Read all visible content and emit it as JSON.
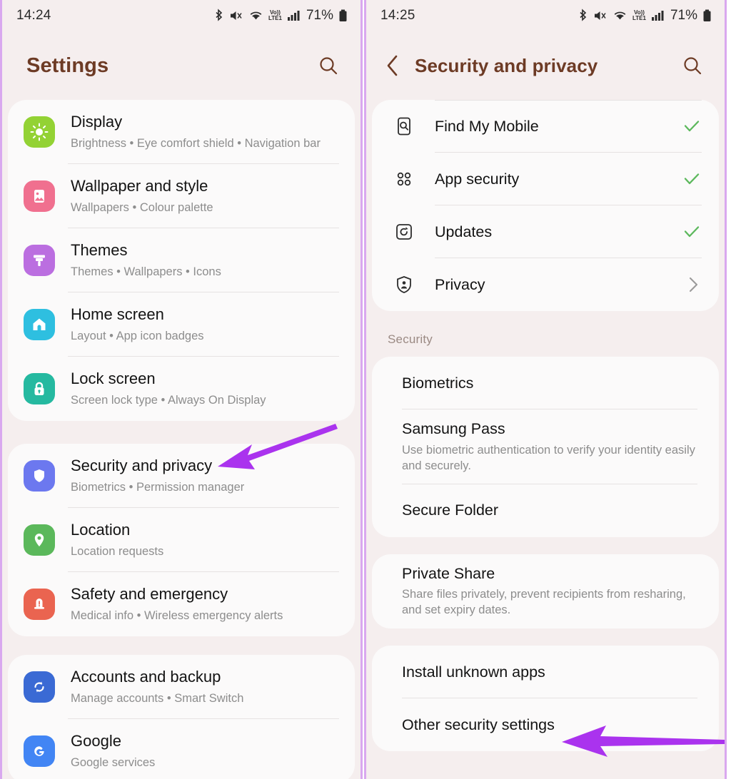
{
  "accent": {
    "arrow": "#aa33ee",
    "panel_border": "#d9a8ef",
    "title_brown": "#6d3b25",
    "check_green": "#5cb85c"
  },
  "left_phone": {
    "statusbar": {
      "clock": "14:24",
      "battery_percent": "71%",
      "icons": [
        "bluetooth-icon",
        "mute-icon",
        "wifi-icon",
        "volte-icon",
        "signal-bars-icon",
        "battery-icon"
      ],
      "volte_label": "Vo)) LTE1"
    },
    "header": {
      "title": "Settings",
      "search_icon": "search-icon"
    },
    "groups": [
      {
        "items": [
          {
            "icon": "display-brightness-icon",
            "color": "#93d234",
            "title": "Display",
            "subtitle": "Brightness  •  Eye comfort shield  •  Navigation bar"
          },
          {
            "icon": "wallpaper-image-icon",
            "color": "#f0708f",
            "title": "Wallpaper and style",
            "subtitle": "Wallpapers  •  Colour palette"
          },
          {
            "icon": "themes-brush-icon",
            "color": "#bb6ee0",
            "title": "Themes",
            "subtitle": "Themes  •  Wallpapers  •  Icons"
          },
          {
            "icon": "home-screen-icon",
            "color": "#2ebfe0",
            "title": "Home screen",
            "subtitle": "Layout  •  App icon badges"
          },
          {
            "icon": "lock-screen-icon",
            "color": "#25b9a0",
            "title": "Lock screen",
            "subtitle": "Screen lock type  •  Always On Display"
          }
        ]
      },
      {
        "items": [
          {
            "icon": "security-shield-icon",
            "color": "#6c78ef",
            "title": "Security and privacy",
            "subtitle": "Biometrics  •  Permission manager"
          },
          {
            "icon": "location-pin-icon",
            "color": "#5bb85b",
            "title": "Location",
            "subtitle": "Location requests"
          },
          {
            "icon": "safety-emergency-icon",
            "color": "#ea6450",
            "title": "Safety and emergency",
            "subtitle": "Medical info  •  Wireless emergency alerts"
          }
        ]
      },
      {
        "items": [
          {
            "icon": "accounts-sync-icon",
            "color": "#3a6ad4",
            "title": "Accounts and backup",
            "subtitle": "Manage accounts  •  Smart Switch"
          },
          {
            "icon": "google-g-icon",
            "color": "#4285f4",
            "title": "Google",
            "subtitle": "Google services"
          }
        ]
      }
    ],
    "annotation": {
      "name": "arrow-pointing-to-security-and-privacy",
      "target": "Security and privacy"
    }
  },
  "right_phone": {
    "statusbar": {
      "clock": "14:25",
      "battery_percent": "71%",
      "icons": [
        "bluetooth-icon",
        "mute-icon",
        "wifi-icon",
        "volte-icon",
        "signal-bars-icon",
        "battery-icon"
      ],
      "volte_label": "Vo)) LTE1"
    },
    "header": {
      "back_icon": "back-chevron-icon",
      "title": "Security and privacy",
      "search_icon": "search-icon"
    },
    "groups": [
      {
        "items": [
          {
            "icon": "find-my-mobile-icon",
            "title": "Find My Mobile",
            "trailing": "check"
          },
          {
            "icon": "app-security-icon",
            "title": "App security",
            "trailing": "check"
          },
          {
            "icon": "updates-icon",
            "title": "Updates",
            "trailing": "check"
          },
          {
            "icon": "privacy-badge-icon",
            "title": "Privacy",
            "trailing": "chevron"
          }
        ]
      },
      {
        "header": "Security",
        "items": [
          {
            "title": "Biometrics"
          },
          {
            "title": "Samsung Pass",
            "subtitle": "Use biometric authentication to verify your identity easily and securely."
          },
          {
            "title": "Secure Folder"
          }
        ]
      },
      {
        "items": [
          {
            "title": "Private Share",
            "subtitle": "Share files privately, prevent recipients from resharing, and set expiry dates."
          }
        ]
      },
      {
        "items": [
          {
            "title": "Install unknown apps"
          },
          {
            "title": "Other security settings"
          }
        ]
      }
    ],
    "annotation": {
      "name": "arrow-pointing-to-other-security-settings",
      "target": "Other security settings"
    }
  }
}
